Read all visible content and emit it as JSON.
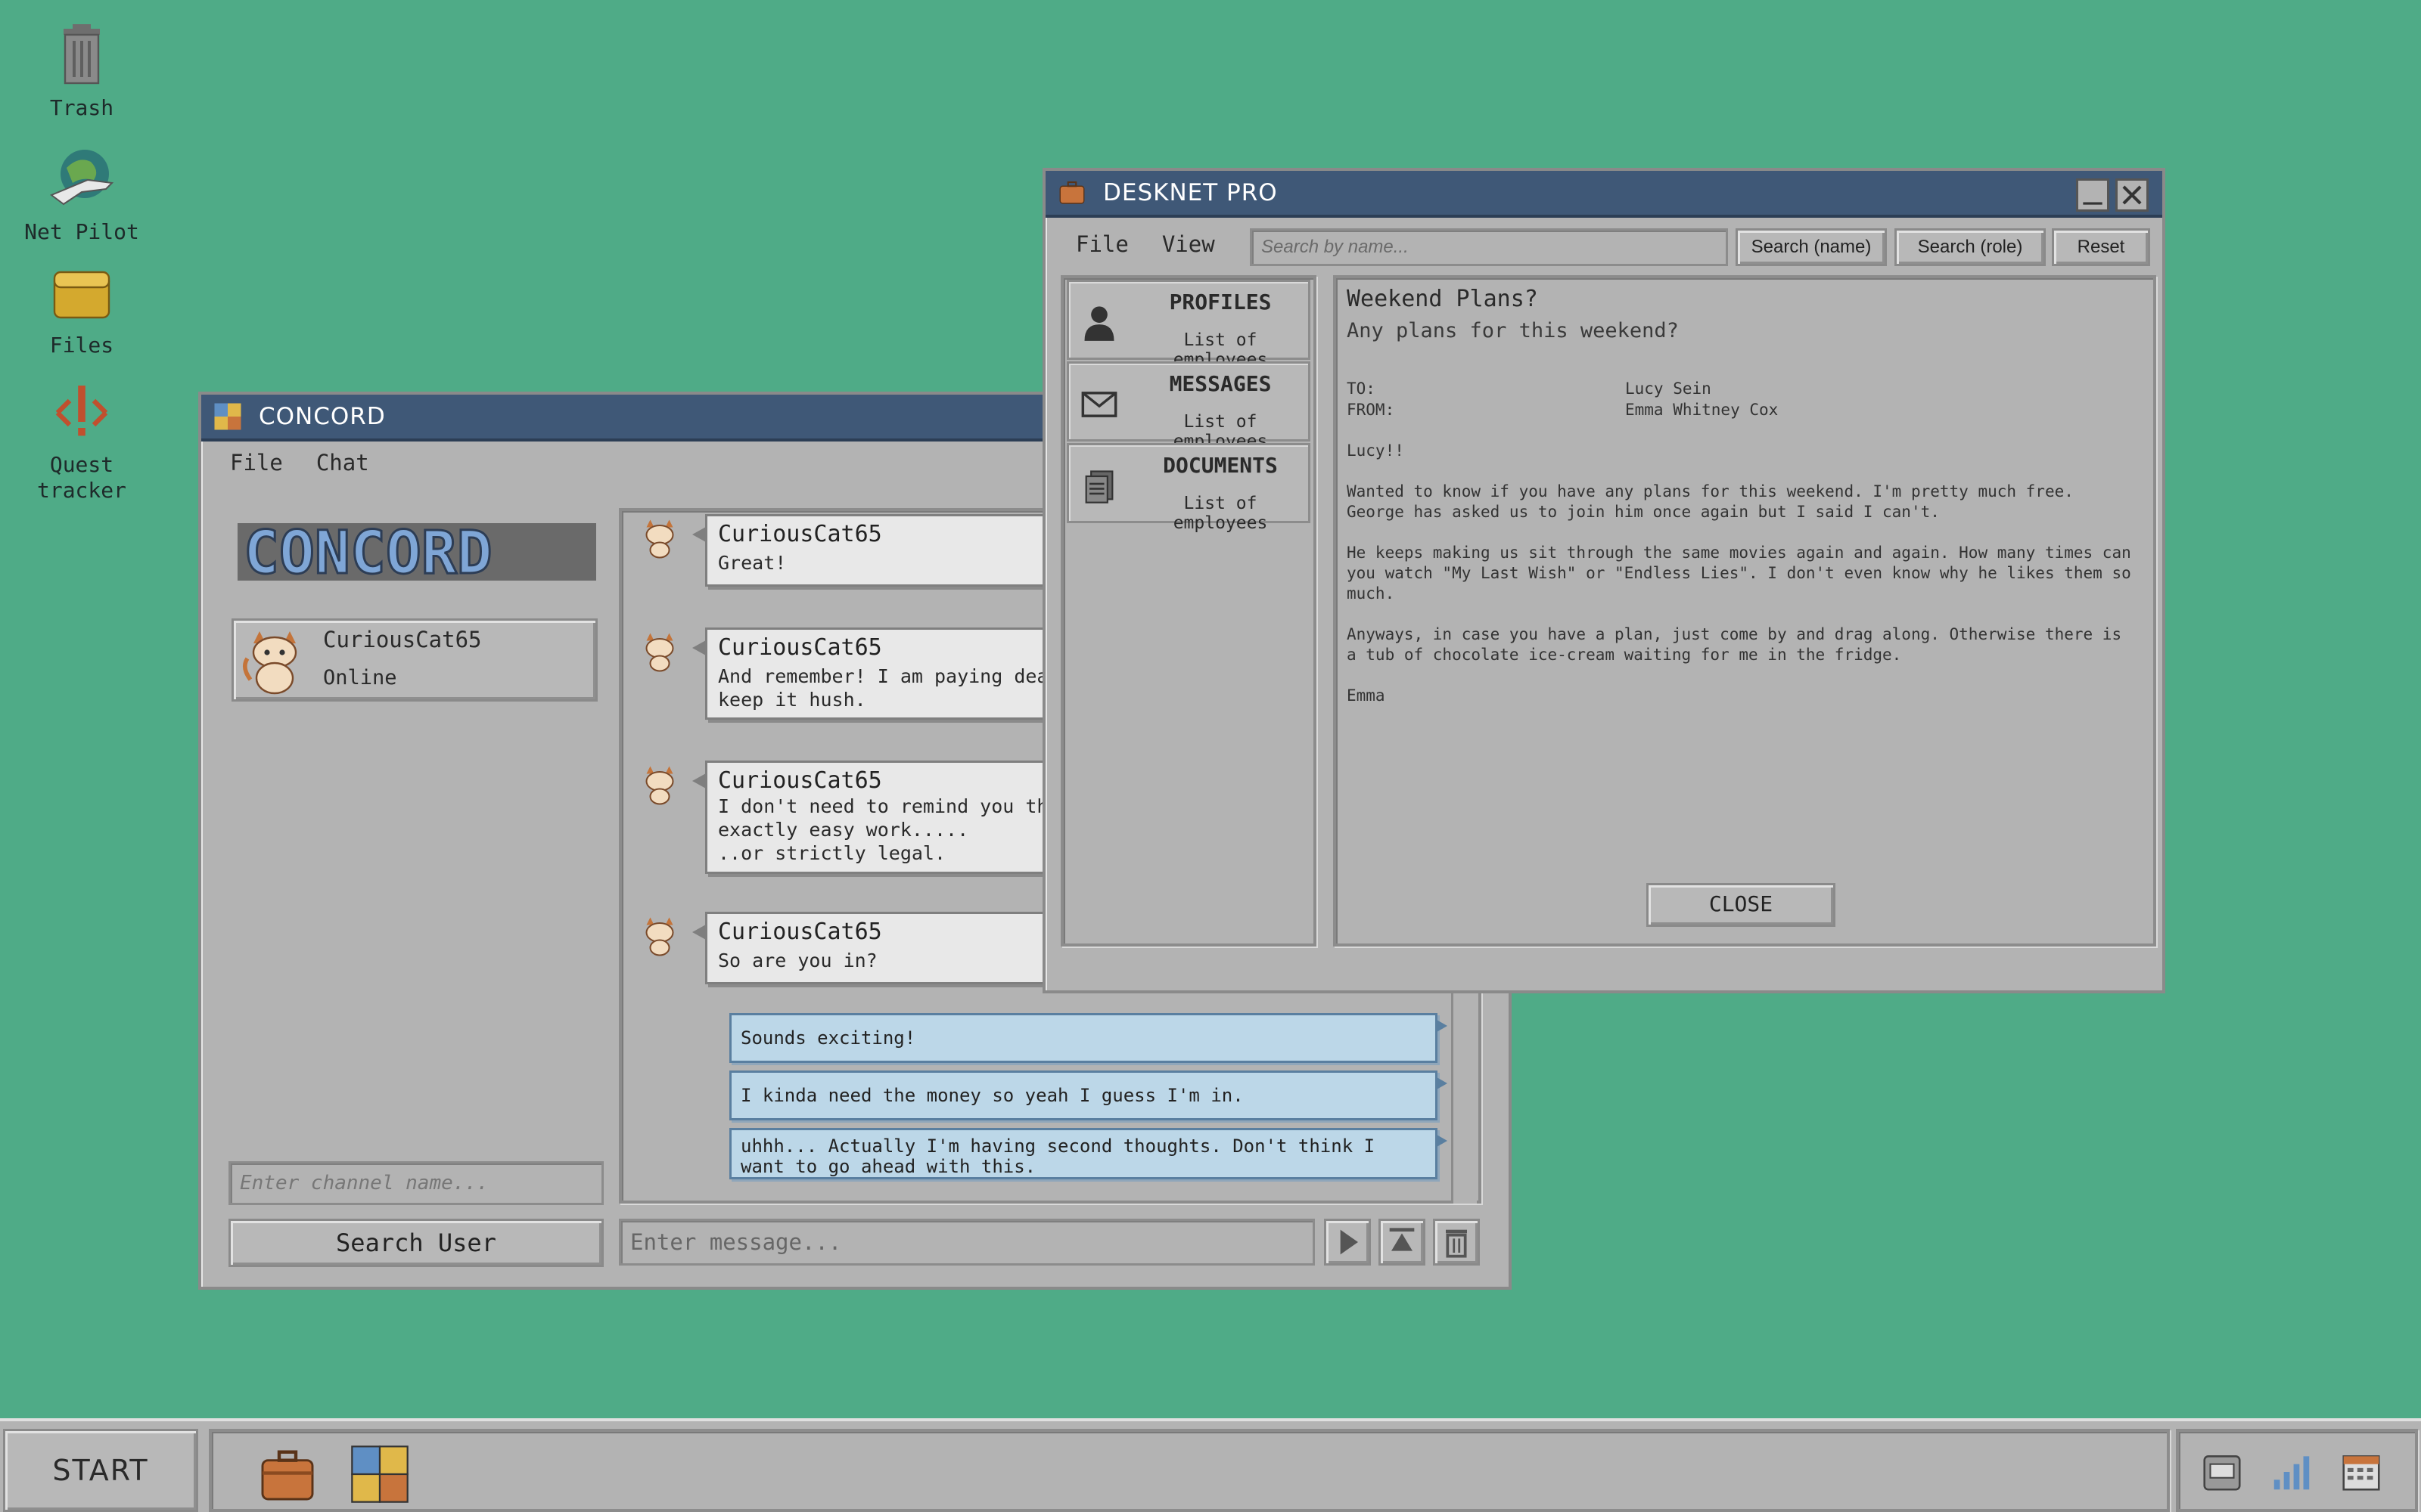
{
  "desktop": {
    "icons": [
      {
        "label": "Trash"
      },
      {
        "label": "Net Pilot"
      },
      {
        "label": "Files"
      },
      {
        "label": "Quest\ntracker"
      }
    ]
  },
  "concord": {
    "title": "CONCORD",
    "menu": [
      "File",
      "Chat"
    ],
    "logo_text": "CONCORD",
    "user": {
      "name": "CuriousCat65",
      "status": "Online"
    },
    "channel_placeholder": "Enter channel name...",
    "search_user_label": "Search User",
    "messages": [
      {
        "sender": "CuriousCat65",
        "text": "Great!"
      },
      {
        "sender": "CuriousCat65",
        "text": "And remember! I am paying dear\nkeep it hush."
      },
      {
        "sender": "CuriousCat65",
        "text": "I don't need to remind you th\nexactly easy work.....\n..or strictly legal."
      },
      {
        "sender": "CuriousCat65",
        "text": "So are you in?"
      }
    ],
    "replies": [
      "Sounds exciting!",
      "I kinda need the money so yeah I guess I'm in.",
      "uhhh... Actually I'm having second thoughts. Don't think I\nwant to go ahead with this."
    ],
    "message_placeholder": "Enter message..."
  },
  "desknet": {
    "title": "DESKNET PRO",
    "menu": [
      "File",
      "View"
    ],
    "search_placeholder": "Search by name...",
    "buttons": {
      "search_name": "Search (name)",
      "search_role": "Search (role)",
      "reset": "Reset"
    },
    "sidebar": [
      {
        "title": "PROFILES",
        "subtitle": "List of employees",
        "icon": "person-icon"
      },
      {
        "title": "MESSAGES",
        "subtitle": "List of employees",
        "icon": "envelope-icon"
      },
      {
        "title": "DOCUMENTS",
        "subtitle": "List of employees",
        "icon": "documents-icon"
      }
    ],
    "message": {
      "subject": "Weekend Plans?",
      "preview": "Any plans for this weekend?",
      "to_label": "TO:",
      "to": "Lucy Sein",
      "from_label": "FROM:",
      "from": "Emma Whitney Cox",
      "body": [
        "Lucy!!",
        "Wanted to know if you have any plans for this weekend. I'm pretty much free.\nGeorge has asked us to join him once again but I said I can't.",
        "He keeps making us sit through the same movies again and again. How many times can\nyou watch \"My Last Wish\" or \"Endless Lies\". I don't even know why he likes them so\nmuch.",
        "Anyways, in case you have a plan, just come by and drag along. Otherwise there is\na tub of chocolate ice-cream waiting for me in the fridge.",
        "Emma"
      ],
      "close_label": "CLOSE"
    }
  },
  "taskbar": {
    "start_label": "START"
  },
  "colors": {
    "desktop": "#4fab87",
    "titlebar": "#3f5877",
    "window": "#b3b3b3",
    "reply_bubble": "#bcd7e8"
  }
}
